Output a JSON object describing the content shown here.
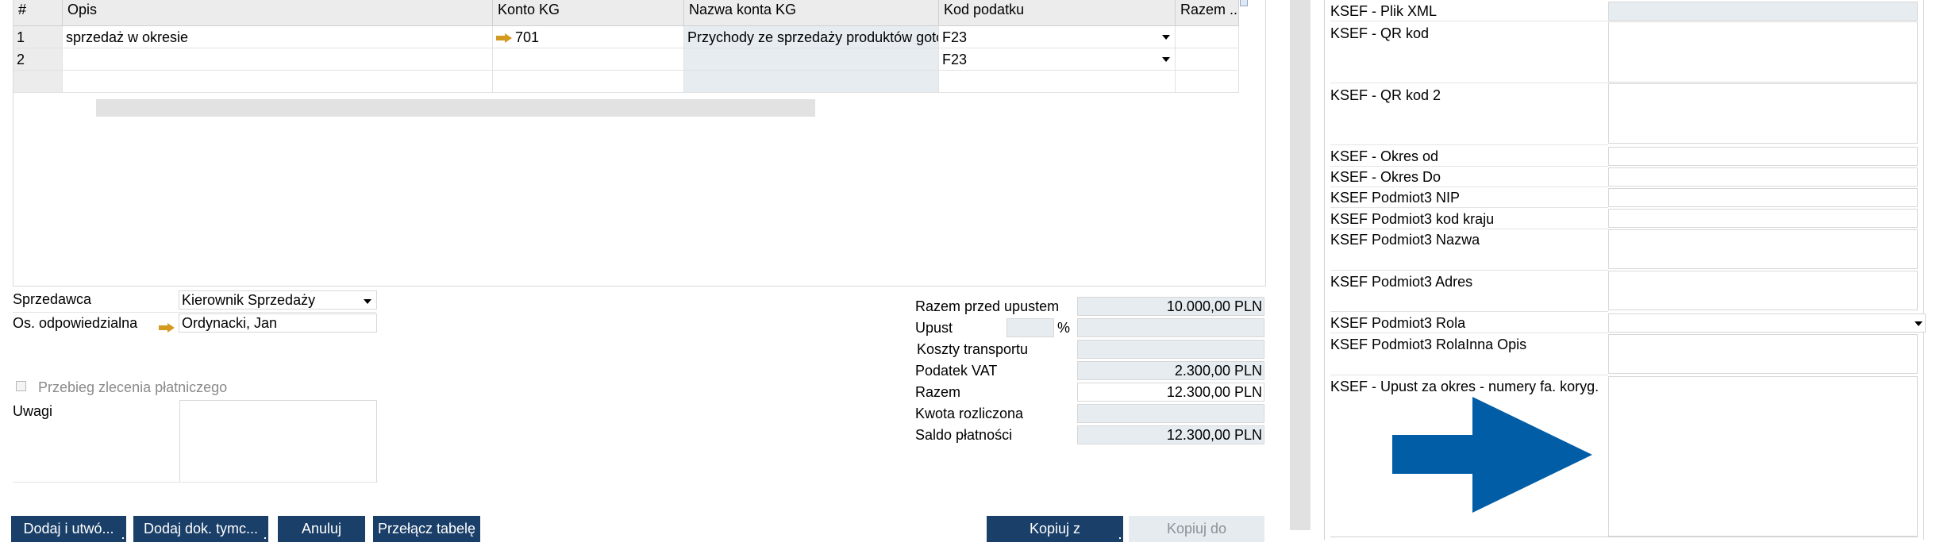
{
  "grid": {
    "headers": [
      "#",
      "Opis",
      "Konto KG",
      "Nazwa konta KG",
      "Kod podatku",
      "Razem ..."
    ],
    "rows": [
      {
        "num": "1",
        "opis": "sprzedaż w okresie",
        "konto": "701",
        "nazwa": "Przychody ze sprzedaży produktów gotow",
        "kod": "F23",
        "razem": ""
      },
      {
        "num": "2",
        "opis": "",
        "konto": "",
        "nazwa": "",
        "kod": "F23",
        "razem": ""
      }
    ]
  },
  "left_form": {
    "sprzedawca_label": "Sprzedawca",
    "sprzedawca_value": "Kierownik Sprzedaży",
    "osoba_label": "Os. odpowiedzialna",
    "osoba_value": "Ordynacki, Jan",
    "przebieg_label": "Przebieg zlecenia płatniczego",
    "uwagi_label": "Uwagi"
  },
  "totals": {
    "razem_przed_label": "Razem przed upustem",
    "razem_przed_value": "10.000,00 PLN",
    "upust_label": "Upust",
    "upust_percent_symbol": "%",
    "koszty_label": "Koszty transportu",
    "vat_label": "Podatek VAT",
    "vat_value": "2.300,00 PLN",
    "razem_label": "Razem",
    "razem_value": "12.300,00 PLN",
    "kwota_label": "Kwota rozliczona",
    "saldo_label": "Saldo płatności",
    "saldo_value": "12.300,00 PLN"
  },
  "buttons": {
    "dodaj_utworz": "Dodaj i utwó...",
    "dodaj_dok": "Dodaj dok. tymc...",
    "anuluj": "Anuluj",
    "przelacz": "Przełącz tabelę",
    "kopiuj_z": "Kopiuj z",
    "kopiuj_do": "Kopiuj do"
  },
  "right_panel": {
    "plik_xml": "KSEF - Plik XML",
    "qr_kod": "KSEF -  QR kod",
    "qr_kod2": "KSEF -  QR kod 2",
    "okres_od": "KSEF - Okres od",
    "okres_do": "KSEF - Okres Do",
    "nip": "KSEF Podmiot3 NIP",
    "kod_kraju": "KSEF Podmiot3 kod kraju",
    "nazwa": "KSEF Podmiot3 Nazwa",
    "adres": "KSEF Podmiot3 Adres",
    "rola": "KSEF Podmiot3 Rola",
    "rola_opis": "KSEF Podmiot3 RolaInna Opis",
    "upust": "KSEF - Upust za okres - numery fa. koryg."
  },
  "colors": {
    "button_bg": "#1a3f68",
    "annotation_arrow": "#005da6",
    "field_gray": "#e7ecf1"
  },
  "icons": [
    "link-arrow-icon",
    "dropdown-icon",
    "checkbox-icon",
    "annotation-arrow-icon"
  ]
}
